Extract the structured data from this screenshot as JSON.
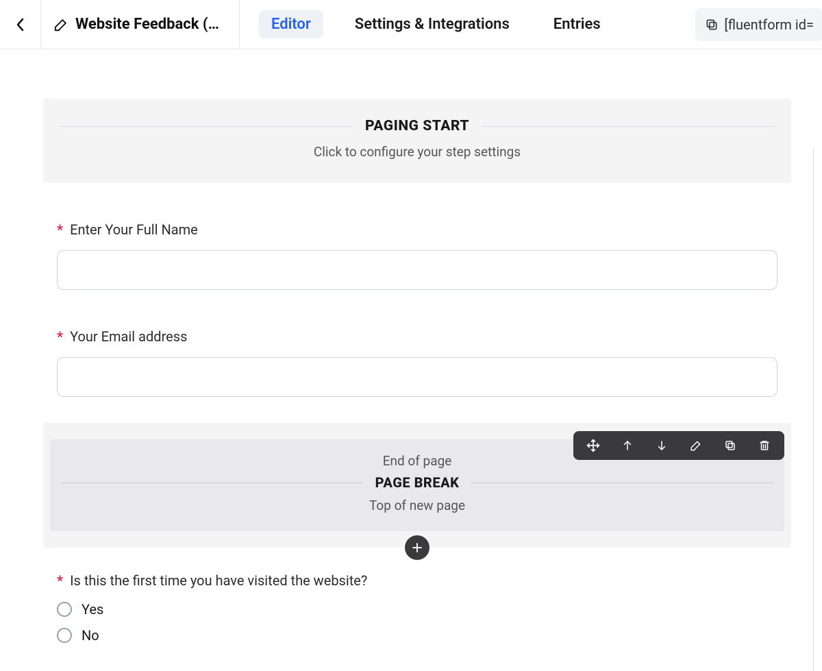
{
  "header": {
    "title": "Website Feedback (…",
    "tabs": {
      "editor": "Editor",
      "settings": "Settings & Integrations",
      "entries": "Entries"
    },
    "shortcode": "[fluentform id="
  },
  "pagingStart": {
    "title": "PAGING START",
    "subtitle": "Click to configure your step settings"
  },
  "fields": {
    "name": {
      "label": "Enter Your Full Name"
    },
    "email": {
      "label": "Your Email address"
    }
  },
  "pageBreak": {
    "top": "End of page",
    "title": "PAGE BREAK",
    "bottom": "Top of new page"
  },
  "radio": {
    "label": "Is this the first time you have visited the website?",
    "options": [
      "Yes",
      "No"
    ]
  }
}
